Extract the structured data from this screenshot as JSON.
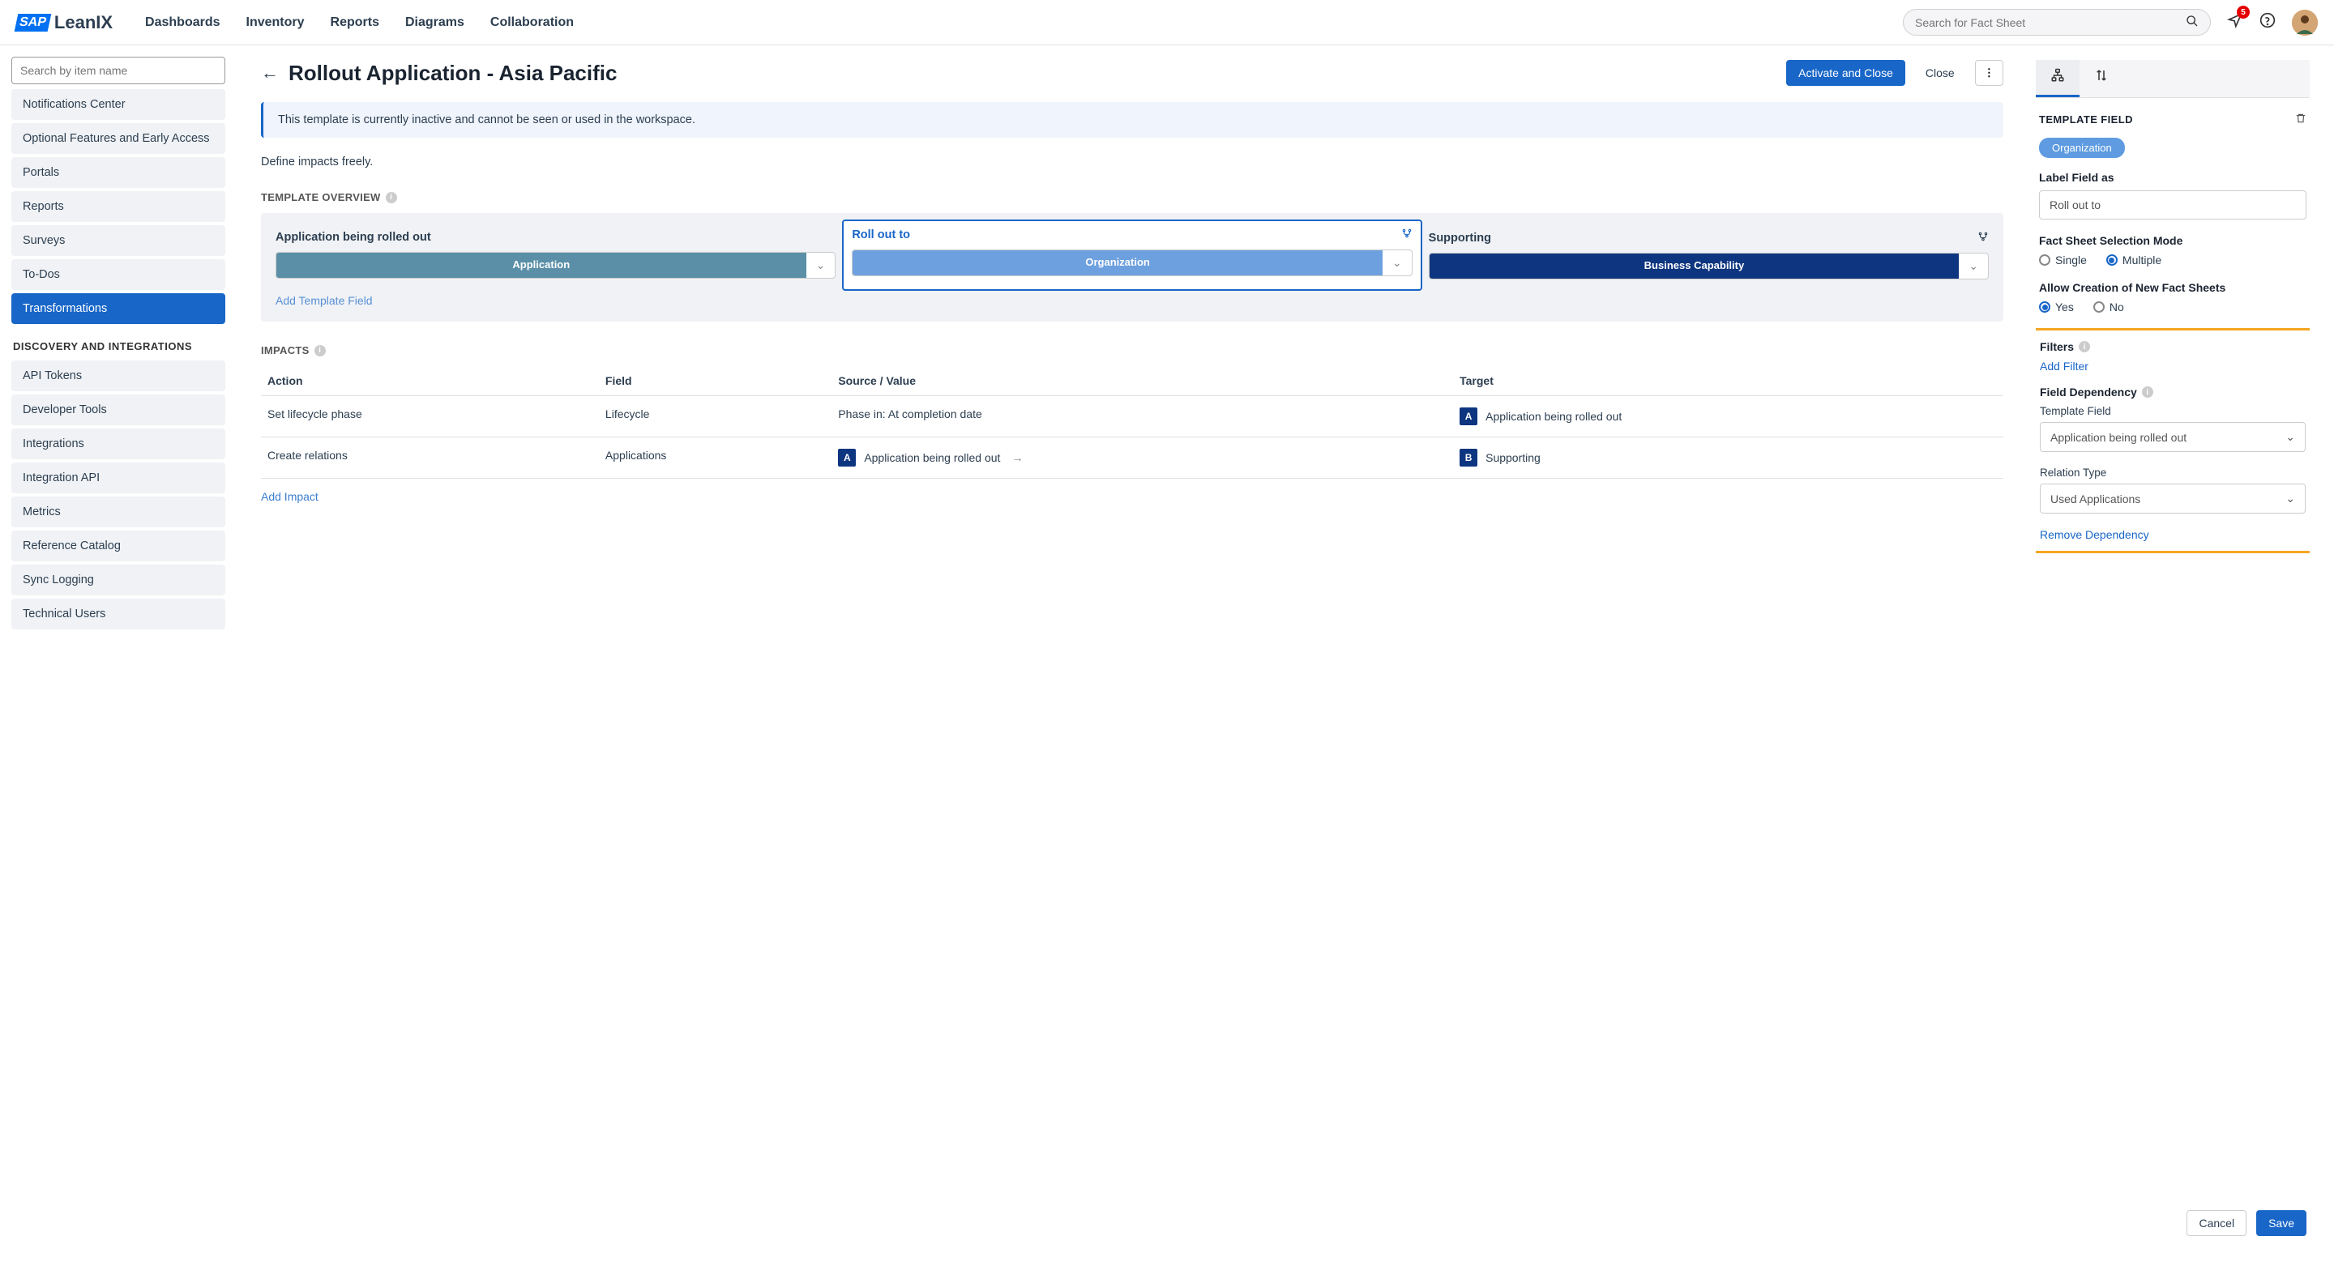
{
  "header": {
    "logo_prefix": "SAP",
    "logo_text": "LeanIX",
    "nav": [
      "Dashboards",
      "Inventory",
      "Reports",
      "Diagrams",
      "Collaboration"
    ],
    "search_placeholder": "Search for Fact Sheet",
    "notification_count": "5"
  },
  "sidebar": {
    "search_placeholder": "Search by item name",
    "items_top": [
      "Notifications Center",
      "Optional Features and Early Access",
      "Portals",
      "Reports",
      "Surveys",
      "To-Dos",
      "Transformations"
    ],
    "active_index": 6,
    "section_label": "DISCOVERY AND INTEGRATIONS",
    "items_bottom": [
      "API Tokens",
      "Developer Tools",
      "Integrations",
      "Integration API",
      "Metrics",
      "Reference Catalog",
      "Sync Logging",
      "Technical Users"
    ]
  },
  "page": {
    "title": "Rollout Application - Asia Pacific",
    "activate_btn": "Activate and Close",
    "close_btn": "Close",
    "banner": "This template is currently inactive and cannot be seen or used in the workspace.",
    "subtitle": "Define impacts freely."
  },
  "overview": {
    "heading": "TEMPLATE OVERVIEW",
    "cards": [
      {
        "title": "Application being rolled out",
        "chip": "Application",
        "chip_class": "chip-application"
      },
      {
        "title": "Roll out to",
        "chip": "Organization",
        "chip_class": "chip-organization"
      },
      {
        "title": "Supporting",
        "chip": "Business Capability",
        "chip_class": "chip-buscap"
      }
    ],
    "add_field": "Add Template Field"
  },
  "impacts": {
    "heading": "IMPACTS",
    "columns": [
      "Action",
      "Field",
      "Source / Value",
      "Target"
    ],
    "rows": [
      {
        "action": "Set lifecycle phase",
        "field": "Lifecycle",
        "source": "Phase in: At completion date",
        "target": [
          {
            "letter": "A",
            "label": "Application being rolled out"
          }
        ]
      },
      {
        "action": "Create relations",
        "field": "Applications",
        "source_tags": [
          {
            "letter": "A",
            "label": "Application being rolled out"
          }
        ],
        "target": [
          {
            "letter": "B",
            "label": "Supporting"
          }
        ]
      }
    ],
    "add_impact": "Add Impact"
  },
  "panel": {
    "section_title": "TEMPLATE FIELD",
    "pill": "Organization",
    "label_field_as": "Label Field as",
    "label_value": "Roll out to",
    "selection_mode_label": "Fact Sheet Selection Mode",
    "selection_options": [
      "Single",
      "Multiple"
    ],
    "selection_selected": 1,
    "allow_creation_label": "Allow Creation of New Fact Sheets",
    "allow_options": [
      "Yes",
      "No"
    ],
    "allow_selected": 0,
    "filters_label": "Filters",
    "add_filter": "Add Filter",
    "dependency_label": "Field Dependency",
    "template_field_label": "Template Field",
    "template_field_value": "Application being rolled out",
    "relation_type_label": "Relation Type",
    "relation_type_value": "Used Applications",
    "remove_dependency": "Remove Dependency",
    "cancel": "Cancel",
    "save": "Save"
  }
}
